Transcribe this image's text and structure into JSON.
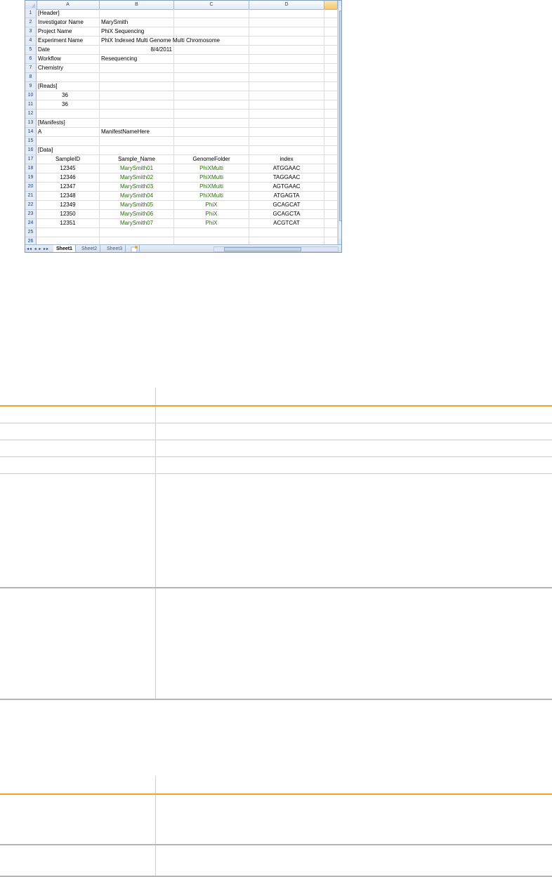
{
  "spreadsheet": {
    "columns": [
      "A",
      "B",
      "C",
      "D"
    ],
    "rows": [
      {
        "n": "1",
        "a": "[Header]",
        "b": "",
        "c": "",
        "d": ""
      },
      {
        "n": "2",
        "a": "Investigator Name",
        "b": "MarySmith",
        "c": "",
        "d": ""
      },
      {
        "n": "3",
        "a": "Project Name",
        "b": "PhiX Sequencing",
        "c": "",
        "d": ""
      },
      {
        "n": "4",
        "a": "Experiment Name",
        "b": "PhiX Indexed Multi Genome Multi Chromosome",
        "c": "",
        "d": ""
      },
      {
        "n": "5",
        "a": "Date",
        "b": "8/4/2011",
        "c": "",
        "d": ""
      },
      {
        "n": "6",
        "a": "Workflow",
        "b": "Resequencing",
        "c": "",
        "d": ""
      },
      {
        "n": "7",
        "a": "Chemistry",
        "b": "",
        "c": "",
        "d": ""
      },
      {
        "n": "8",
        "a": "",
        "b": "",
        "c": "",
        "d": ""
      },
      {
        "n": "9",
        "a": "[Reads]",
        "b": "",
        "c": "",
        "d": ""
      },
      {
        "n": "10",
        "a": "36",
        "b": "",
        "c": "",
        "d": ""
      },
      {
        "n": "11",
        "a": "36",
        "b": "",
        "c": "",
        "d": ""
      },
      {
        "n": "12",
        "a": "",
        "b": "",
        "c": "",
        "d": ""
      },
      {
        "n": "13",
        "a": "[Manifests]",
        "b": "",
        "c": "",
        "d": ""
      },
      {
        "n": "14",
        "a": "A",
        "b": "ManifestNameHere",
        "c": "",
        "d": ""
      },
      {
        "n": "15",
        "a": "",
        "b": "",
        "c": "",
        "d": ""
      },
      {
        "n": "16",
        "a": "[Data]",
        "b": "",
        "c": "",
        "d": ""
      },
      {
        "n": "17",
        "a": "SampleID",
        "b": "Sample_Name",
        "c": "GenomeFolder",
        "d": "index"
      },
      {
        "n": "18",
        "a": "12345",
        "b": "MarySmith01",
        "c": "PhiXMulti",
        "d": "ATGGAAC"
      },
      {
        "n": "19",
        "a": "12346",
        "b": "MarySmith02",
        "c": "PhiXMulti",
        "d": "TAGGAAC"
      },
      {
        "n": "20",
        "a": "12347",
        "b": "MarySmith03",
        "c": "PhiXMulti",
        "d": "AGTGAAC"
      },
      {
        "n": "21",
        "a": "12348",
        "b": "MarySmith04",
        "c": "PhiXMulti",
        "d": "ATGAGTA"
      },
      {
        "n": "22",
        "a": "12349",
        "b": "MarySmith05",
        "c": "PhiX",
        "d": "GCAGCAT"
      },
      {
        "n": "23",
        "a": "12350",
        "b": "MarySmith06",
        "c": "PhiX",
        "d": "GCAGCTA"
      },
      {
        "n": "24",
        "a": "12351",
        "b": "MarySmith07",
        "c": "PhiX",
        "d": "ACGTCAT"
      },
      {
        "n": "25",
        "a": "",
        "b": "",
        "c": "",
        "d": ""
      },
      {
        "n": "26",
        "a": "",
        "b": "",
        "c": "",
        "d": ""
      }
    ],
    "tabs": [
      "Sheet1",
      "Sheet2",
      "Sheet3"
    ],
    "active_tab": "Sheet1",
    "nav_glyphs": "◂◂ ◂ ▸ ▸▸"
  },
  "colors": {
    "accent_rule": "#f2a31b",
    "data_text": "#2e6b14",
    "grid_header": "#e4ecf7"
  }
}
